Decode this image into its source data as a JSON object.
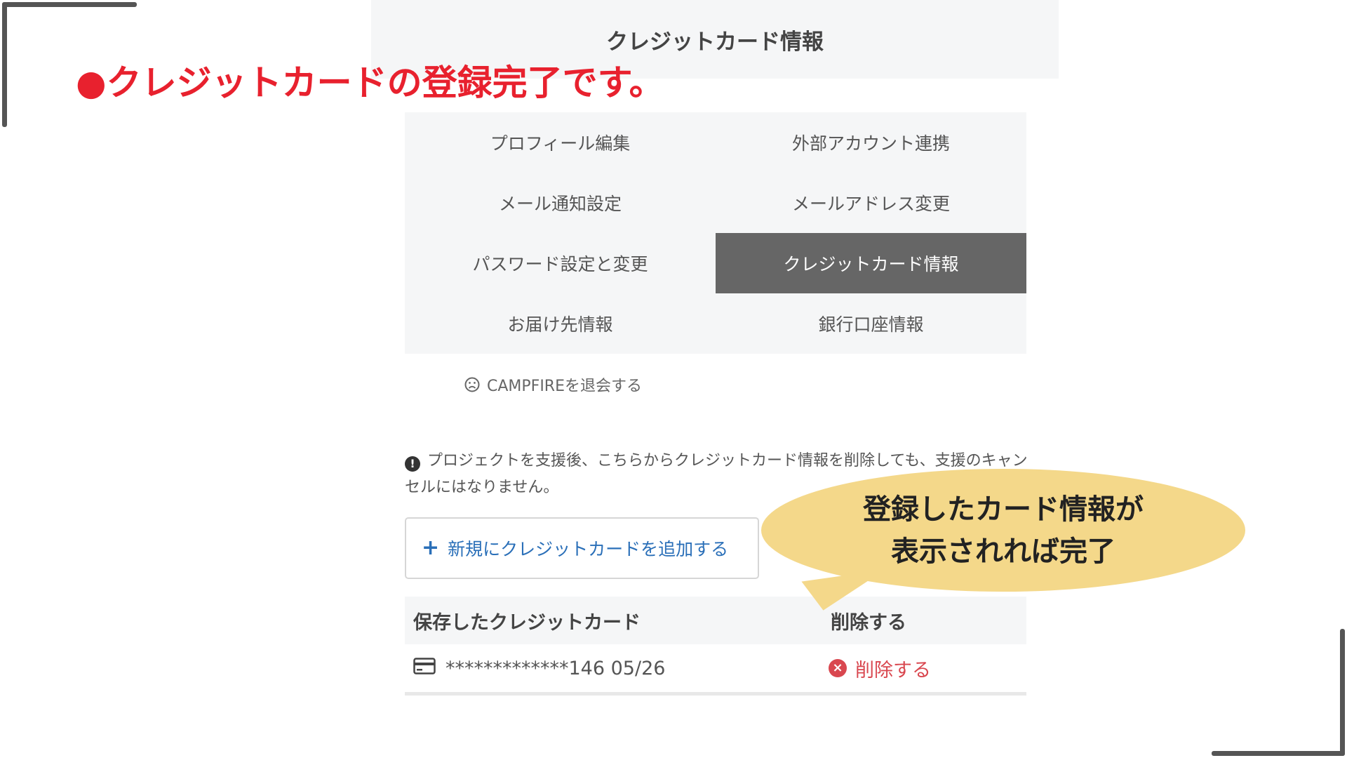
{
  "annotation": {
    "title": "●クレジットカードの登録完了です。",
    "callout_line1": "登録したカード情報が",
    "callout_line2": "表示されれば完了",
    "title_color": "#e8212e",
    "callout_color": "#f4d88a"
  },
  "header": {
    "title": "クレジットカード情報"
  },
  "menu": {
    "items": [
      {
        "label": "プロフィール編集",
        "active": false
      },
      {
        "label": "外部アカウント連携",
        "active": false
      },
      {
        "label": "メール通知設定",
        "active": false
      },
      {
        "label": "メールアドレス変更",
        "active": false
      },
      {
        "label": "パスワード設定と変更",
        "active": false
      },
      {
        "label": "クレジットカード情報",
        "active": true
      },
      {
        "label": "お届け先情報",
        "active": false
      },
      {
        "label": "銀行口座情報",
        "active": false
      }
    ],
    "active_color": "#666666"
  },
  "withdraw": {
    "label": "CAMPFIREを退会する",
    "icon": "sad-face-icon"
  },
  "notice": {
    "icon": "exclamation-icon",
    "text": "プロジェクトを支援後、こちらからクレジットカード情報を削除しても、支援のキャンセルにはなりません。"
  },
  "add_card": {
    "icon": "plus-icon",
    "label": "新規にクレジットカードを追加する",
    "color": "#2a6fb8"
  },
  "cards_table": {
    "headers": [
      "保存したクレジットカード",
      "削除する"
    ],
    "rows": [
      {
        "card": "*************146 05/26",
        "delete_label": "削除する"
      }
    ],
    "delete_color": "#d9474f"
  }
}
